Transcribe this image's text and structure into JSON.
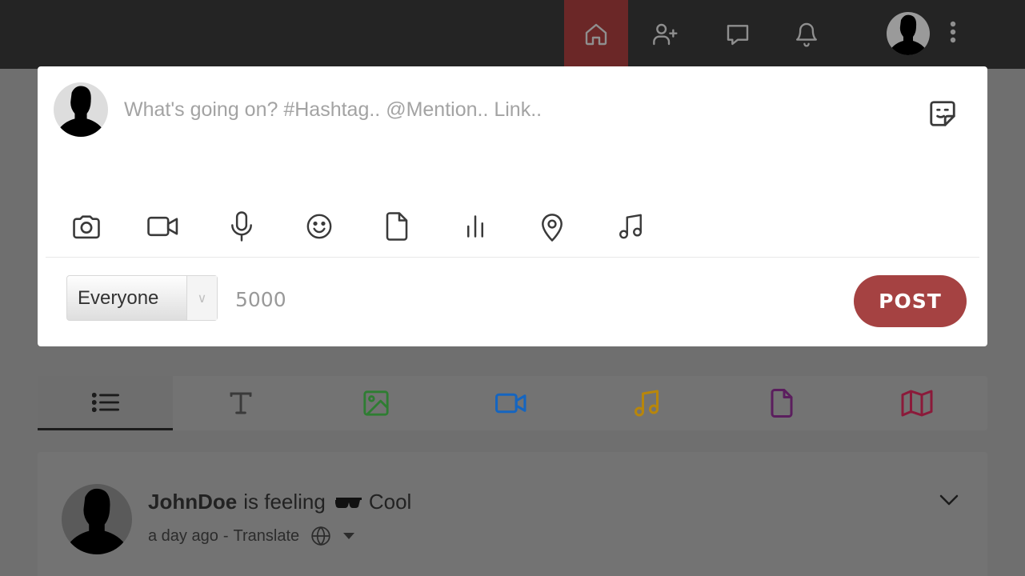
{
  "nav": {
    "items": [
      {
        "name": "home",
        "icon": "home-icon",
        "active": true
      },
      {
        "name": "add-friend",
        "icon": "user-plus-icon"
      },
      {
        "name": "messages",
        "icon": "chat-icon"
      },
      {
        "name": "notifications",
        "icon": "bell-icon"
      }
    ],
    "avatar_icon": "user-silhouette",
    "more_icon": "vertical-dots-icon",
    "active_color": "#6b2727"
  },
  "composer": {
    "placeholder": "What's going on? #Hashtag.. @Mention.. Link..",
    "sticker_icon": "sticker-icon",
    "tools": [
      "camera-icon",
      "video-icon",
      "microphone-icon",
      "smiley-icon",
      "file-icon",
      "poll-icon",
      "location-icon",
      "music-icon"
    ],
    "audience": "Everyone",
    "char_limit": "5000",
    "post_label": "POST",
    "post_color": "#a54242"
  },
  "filter_tabs": [
    {
      "icon": "list-icon",
      "active": true
    },
    {
      "icon": "text-icon",
      "color": "#3a3a3a"
    },
    {
      "icon": "image-icon",
      "color": "#2e7d32"
    },
    {
      "icon": "video-icon",
      "color": "#1565c0"
    },
    {
      "icon": "music-icon",
      "color": "#b8860b"
    },
    {
      "icon": "file-icon",
      "color": "#5b1e5e"
    },
    {
      "icon": "map-icon",
      "color": "#8b1a3a"
    }
  ],
  "post": {
    "author": "JohnDoe",
    "feeling_text": "is feeling",
    "feeling": "Cool",
    "time": "a day ago",
    "separator": "-",
    "translate": "Translate"
  }
}
